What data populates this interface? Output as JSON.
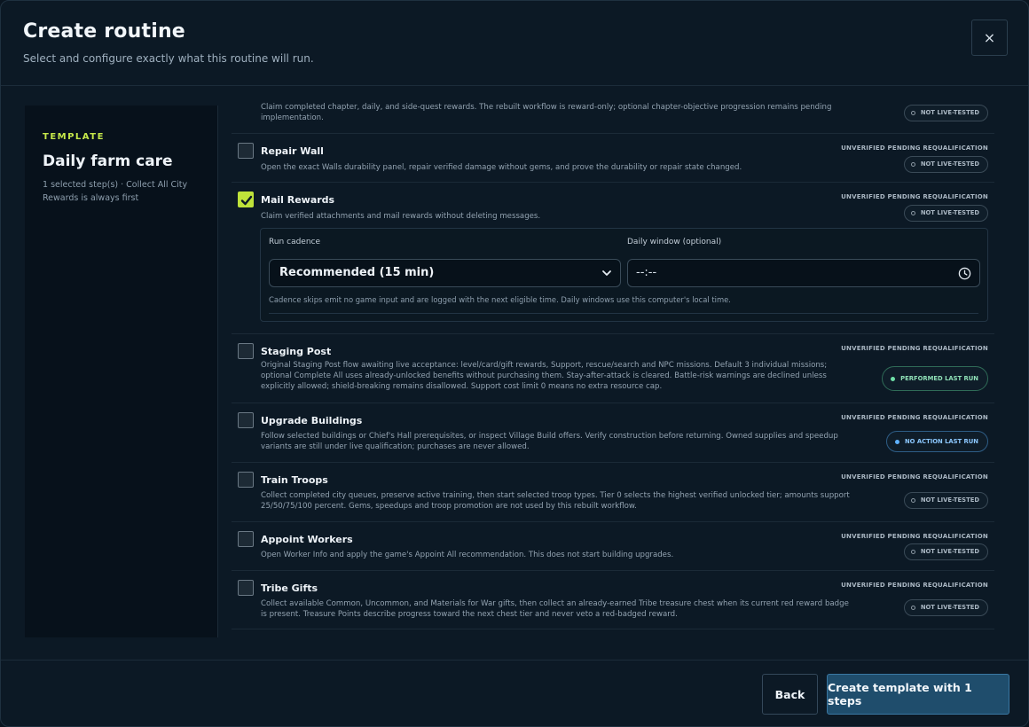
{
  "header": {
    "title": "Create routine",
    "subtitle": "Select and configure exactly what this routine will run.",
    "close_label": "×"
  },
  "sidebar": {
    "label": "TEMPLATE",
    "name": "Daily farm care",
    "description": "1 selected step(s) · Collect All City Rewards is always first"
  },
  "steps": [
    {
      "title": "",
      "checked": false,
      "description": "Claim completed chapter, daily, and side-quest rewards. The rebuilt workflow is reward-only; optional chapter-objective progression remains pending implementation.",
      "status": "",
      "badge": "NOT LIVE-TESTED"
    },
    {
      "title": "Repair Wall",
      "checked": false,
      "description": "Open the exact Walls durability panel, repair verified damage without gems, and prove the durability or repair state changed.",
      "status": "UNVERIFIED PENDING REQUALIFICATION",
      "badge": "NOT LIVE-TESTED"
    },
    {
      "title": "Mail Rewards",
      "checked": true,
      "description": "Claim verified attachments and mail rewards without deleting messages.",
      "status": "UNVERIFIED PENDING REQUALIFICATION",
      "badge": "NOT LIVE-TESTED"
    },
    {
      "title": "Staging Post",
      "checked": false,
      "description": "Original Staging Post flow awaiting live acceptance: level/card/gift rewards, Support, rescue/search and NPC missions. Default 3 individual missions; optional Complete All uses already-unlocked benefits without purchasing them. Stay-after-attack is cleared. Battle-risk warnings are declined unless explicitly allowed; shield-breaking remains disallowed. Support cost limit 0 means no extra resource cap.",
      "status": "UNVERIFIED PENDING REQUALIFICATION",
      "badge": "PERFORMED LAST RUN"
    },
    {
      "title": "Upgrade Buildings",
      "checked": false,
      "description": "Follow selected buildings or Chief's Hall prerequisites, or inspect Village Build offers. Verify construction before returning. Owned supplies and speedup variants are still under live qualification; purchases are never allowed.",
      "status": "UNVERIFIED PENDING REQUALIFICATION",
      "badge": "NO ACTION LAST RUN"
    },
    {
      "title": "Train Troops",
      "checked": false,
      "description": "Collect completed city queues, preserve active training, then start selected troop types. Tier 0 selects the highest verified unlocked tier; amounts support 25/50/75/100 percent. Gems, speedups and troop promotion are not used by this rebuilt workflow.",
      "status": "UNVERIFIED PENDING REQUALIFICATION",
      "badge": "NOT LIVE-TESTED"
    },
    {
      "title": "Appoint Workers",
      "checked": false,
      "description": "Open Worker Info and apply the game's Appoint All recommendation. This does not start building upgrades.",
      "status": "UNVERIFIED PENDING REQUALIFICATION",
      "badge": "NOT LIVE-TESTED"
    },
    {
      "title": "Tribe Gifts",
      "checked": false,
      "description": "Collect available Common, Uncommon, and Materials for War gifts, then collect an already-earned Tribe treasure chest when its current red reward badge is present. Treasure Points describe progress toward the next chest tier and never veto a red-badged reward.",
      "status": "UNVERIFIED PENDING REQUALIFICATION",
      "badge": "NOT LIVE-TESTED"
    }
  ],
  "cadence": {
    "run_label": "Run cadence",
    "run_value": "Recommended (15 min)",
    "window_label": "Daily window (optional)",
    "window_value": "--:--",
    "help": "Cadence skips emit no game input and are logged with the next eligible time. Daily windows use this computer's local time."
  },
  "footer": {
    "back_label": "Back",
    "create_label": "Create template with 1 steps"
  },
  "colors": {
    "accent": "#c6e84a",
    "primary_button": "#1f4d6c",
    "performed": "#6fe0a8",
    "no_action": "#5fb2ff"
  }
}
